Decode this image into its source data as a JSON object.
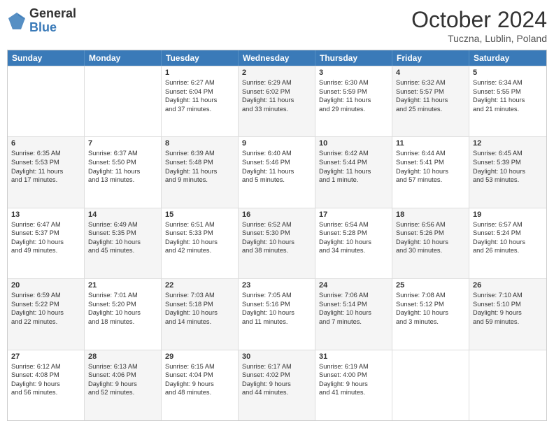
{
  "header": {
    "logo_general": "General",
    "logo_blue": "Blue",
    "month_title": "October 2024",
    "subtitle": "Tuczna, Lublin, Poland"
  },
  "days_of_week": [
    "Sunday",
    "Monday",
    "Tuesday",
    "Wednesday",
    "Thursday",
    "Friday",
    "Saturday"
  ],
  "rows": [
    [
      {
        "day": "",
        "lines": [],
        "bg": "empty"
      },
      {
        "day": "",
        "lines": [],
        "bg": "empty"
      },
      {
        "day": "1",
        "lines": [
          "Sunrise: 6:27 AM",
          "Sunset: 6:04 PM",
          "Daylight: 11 hours",
          "and 37 minutes."
        ],
        "bg": "white"
      },
      {
        "day": "2",
        "lines": [
          "Sunrise: 6:29 AM",
          "Sunset: 6:02 PM",
          "Daylight: 11 hours",
          "and 33 minutes."
        ],
        "bg": "alt"
      },
      {
        "day": "3",
        "lines": [
          "Sunrise: 6:30 AM",
          "Sunset: 5:59 PM",
          "Daylight: 11 hours",
          "and 29 minutes."
        ],
        "bg": "white"
      },
      {
        "day": "4",
        "lines": [
          "Sunrise: 6:32 AM",
          "Sunset: 5:57 PM",
          "Daylight: 11 hours",
          "and 25 minutes."
        ],
        "bg": "alt"
      },
      {
        "day": "5",
        "lines": [
          "Sunrise: 6:34 AM",
          "Sunset: 5:55 PM",
          "Daylight: 11 hours",
          "and 21 minutes."
        ],
        "bg": "white"
      }
    ],
    [
      {
        "day": "6",
        "lines": [
          "Sunrise: 6:35 AM",
          "Sunset: 5:53 PM",
          "Daylight: 11 hours",
          "and 17 minutes."
        ],
        "bg": "alt"
      },
      {
        "day": "7",
        "lines": [
          "Sunrise: 6:37 AM",
          "Sunset: 5:50 PM",
          "Daylight: 11 hours",
          "and 13 minutes."
        ],
        "bg": "white"
      },
      {
        "day": "8",
        "lines": [
          "Sunrise: 6:39 AM",
          "Sunset: 5:48 PM",
          "Daylight: 11 hours",
          "and 9 minutes."
        ],
        "bg": "alt"
      },
      {
        "day": "9",
        "lines": [
          "Sunrise: 6:40 AM",
          "Sunset: 5:46 PM",
          "Daylight: 11 hours",
          "and 5 minutes."
        ],
        "bg": "white"
      },
      {
        "day": "10",
        "lines": [
          "Sunrise: 6:42 AM",
          "Sunset: 5:44 PM",
          "Daylight: 11 hours",
          "and 1 minute."
        ],
        "bg": "alt"
      },
      {
        "day": "11",
        "lines": [
          "Sunrise: 6:44 AM",
          "Sunset: 5:41 PM",
          "Daylight: 10 hours",
          "and 57 minutes."
        ],
        "bg": "white"
      },
      {
        "day": "12",
        "lines": [
          "Sunrise: 6:45 AM",
          "Sunset: 5:39 PM",
          "Daylight: 10 hours",
          "and 53 minutes."
        ],
        "bg": "alt"
      }
    ],
    [
      {
        "day": "13",
        "lines": [
          "Sunrise: 6:47 AM",
          "Sunset: 5:37 PM",
          "Daylight: 10 hours",
          "and 49 minutes."
        ],
        "bg": "white"
      },
      {
        "day": "14",
        "lines": [
          "Sunrise: 6:49 AM",
          "Sunset: 5:35 PM",
          "Daylight: 10 hours",
          "and 45 minutes."
        ],
        "bg": "alt"
      },
      {
        "day": "15",
        "lines": [
          "Sunrise: 6:51 AM",
          "Sunset: 5:33 PM",
          "Daylight: 10 hours",
          "and 42 minutes."
        ],
        "bg": "white"
      },
      {
        "day": "16",
        "lines": [
          "Sunrise: 6:52 AM",
          "Sunset: 5:30 PM",
          "Daylight: 10 hours",
          "and 38 minutes."
        ],
        "bg": "alt"
      },
      {
        "day": "17",
        "lines": [
          "Sunrise: 6:54 AM",
          "Sunset: 5:28 PM",
          "Daylight: 10 hours",
          "and 34 minutes."
        ],
        "bg": "white"
      },
      {
        "day": "18",
        "lines": [
          "Sunrise: 6:56 AM",
          "Sunset: 5:26 PM",
          "Daylight: 10 hours",
          "and 30 minutes."
        ],
        "bg": "alt"
      },
      {
        "day": "19",
        "lines": [
          "Sunrise: 6:57 AM",
          "Sunset: 5:24 PM",
          "Daylight: 10 hours",
          "and 26 minutes."
        ],
        "bg": "white"
      }
    ],
    [
      {
        "day": "20",
        "lines": [
          "Sunrise: 6:59 AM",
          "Sunset: 5:22 PM",
          "Daylight: 10 hours",
          "and 22 minutes."
        ],
        "bg": "alt"
      },
      {
        "day": "21",
        "lines": [
          "Sunrise: 7:01 AM",
          "Sunset: 5:20 PM",
          "Daylight: 10 hours",
          "and 18 minutes."
        ],
        "bg": "white"
      },
      {
        "day": "22",
        "lines": [
          "Sunrise: 7:03 AM",
          "Sunset: 5:18 PM",
          "Daylight: 10 hours",
          "and 14 minutes."
        ],
        "bg": "alt"
      },
      {
        "day": "23",
        "lines": [
          "Sunrise: 7:05 AM",
          "Sunset: 5:16 PM",
          "Daylight: 10 hours",
          "and 11 minutes."
        ],
        "bg": "white"
      },
      {
        "day": "24",
        "lines": [
          "Sunrise: 7:06 AM",
          "Sunset: 5:14 PM",
          "Daylight: 10 hours",
          "and 7 minutes."
        ],
        "bg": "alt"
      },
      {
        "day": "25",
        "lines": [
          "Sunrise: 7:08 AM",
          "Sunset: 5:12 PM",
          "Daylight: 10 hours",
          "and 3 minutes."
        ],
        "bg": "white"
      },
      {
        "day": "26",
        "lines": [
          "Sunrise: 7:10 AM",
          "Sunset: 5:10 PM",
          "Daylight: 9 hours",
          "and 59 minutes."
        ],
        "bg": "alt"
      }
    ],
    [
      {
        "day": "27",
        "lines": [
          "Sunrise: 6:12 AM",
          "Sunset: 4:08 PM",
          "Daylight: 9 hours",
          "and 56 minutes."
        ],
        "bg": "white"
      },
      {
        "day": "28",
        "lines": [
          "Sunrise: 6:13 AM",
          "Sunset: 4:06 PM",
          "Daylight: 9 hours",
          "and 52 minutes."
        ],
        "bg": "alt"
      },
      {
        "day": "29",
        "lines": [
          "Sunrise: 6:15 AM",
          "Sunset: 4:04 PM",
          "Daylight: 9 hours",
          "and 48 minutes."
        ],
        "bg": "white"
      },
      {
        "day": "30",
        "lines": [
          "Sunrise: 6:17 AM",
          "Sunset: 4:02 PM",
          "Daylight: 9 hours",
          "and 44 minutes."
        ],
        "bg": "alt"
      },
      {
        "day": "31",
        "lines": [
          "Sunrise: 6:19 AM",
          "Sunset: 4:00 PM",
          "Daylight: 9 hours",
          "and 41 minutes."
        ],
        "bg": "white"
      },
      {
        "day": "",
        "lines": [],
        "bg": "empty"
      },
      {
        "day": "",
        "lines": [],
        "bg": "empty"
      }
    ]
  ]
}
